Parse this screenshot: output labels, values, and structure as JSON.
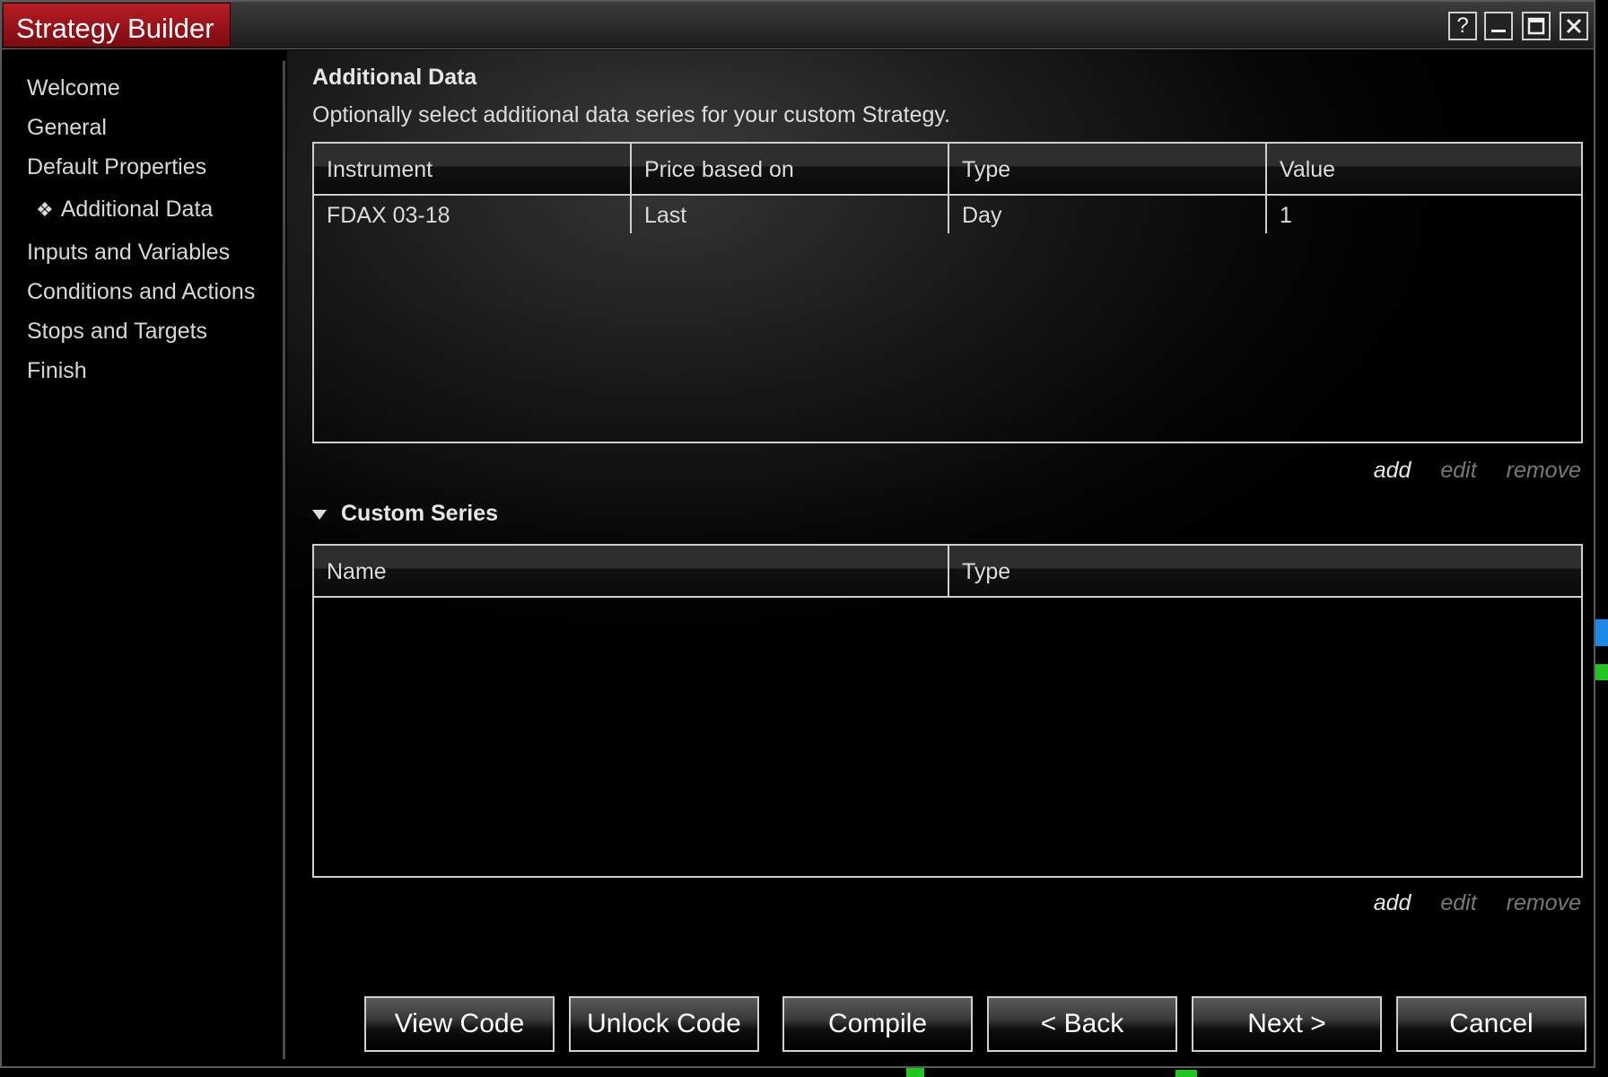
{
  "window": {
    "title": "Strategy Builder",
    "controls": {
      "help": "?",
      "minimize": "_",
      "maximize": "□",
      "close": "✕"
    }
  },
  "sidebar": {
    "items": [
      {
        "label": "Welcome",
        "active": false
      },
      {
        "label": "General",
        "active": false
      },
      {
        "label": "Default Properties",
        "active": false
      },
      {
        "label": "Additional Data",
        "active": true,
        "bullet": "❖"
      },
      {
        "label": "Inputs and Variables",
        "active": false
      },
      {
        "label": "Conditions and Actions",
        "active": false
      },
      {
        "label": "Stops and Targets",
        "active": false
      },
      {
        "label": "Finish",
        "active": false
      }
    ]
  },
  "additional_data": {
    "title": "Additional Data",
    "description": "Optionally select additional data series for your custom Strategy.",
    "columns": [
      "Instrument",
      "Price based on",
      "Type",
      "Value"
    ],
    "rows": [
      [
        "FDAX 03-18",
        "Last",
        "Day",
        "1"
      ]
    ],
    "actions": {
      "add": "add",
      "edit": "edit",
      "remove": "remove"
    }
  },
  "custom_series": {
    "title": "Custom Series",
    "columns": [
      "Name",
      "Type"
    ],
    "rows": [],
    "actions": {
      "add": "add",
      "edit": "edit",
      "remove": "remove"
    }
  },
  "footer": {
    "buttons": [
      "View Code",
      "Unlock Code",
      "Compile",
      "< Back",
      "Next >",
      "Cancel"
    ]
  },
  "colors": {
    "title_accent": "#b91c24",
    "background": "#000000",
    "text": "#dcdcdc",
    "disabled_link": "#777777"
  }
}
